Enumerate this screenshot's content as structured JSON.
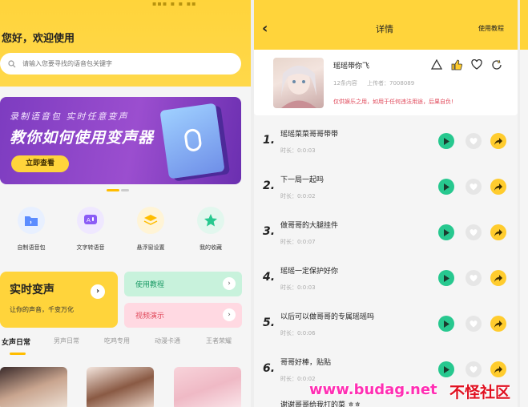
{
  "left": {
    "greeting": "您好，欢迎使用",
    "search": {
      "placeholder": "请输入您要寻找的语音包关键字",
      "icon": "search-icon"
    },
    "banner": {
      "subtitle": "录制语音包 实时任意变声",
      "title": "教你如何使用变声器",
      "button": "立即查看"
    },
    "quick_actions": [
      {
        "label": "自制语音包",
        "icon": "folder-voice-icon",
        "color": "#e8f0ff"
      },
      {
        "label": "文字转语音",
        "icon": "text-to-voice-icon",
        "color": "#efe8ff"
      },
      {
        "label": "悬浮窗设置",
        "icon": "floating-window-icon",
        "color": "#fff4d6"
      },
      {
        "label": "我的收藏",
        "icon": "star-icon",
        "color": "#e2f7ee"
      }
    ],
    "realtime": {
      "title": "实时变声",
      "subtitle": "让你的声音，千变万化"
    },
    "tutorial_card": {
      "label": "使用教程",
      "color": "#c8f2dc"
    },
    "demo_card": {
      "label": "视频演示",
      "color": "#ffd9e2"
    },
    "tabs": [
      "女声日常",
      "男声日常",
      "吃鸡专用",
      "动漫卡通",
      "王者荣耀"
    ],
    "active_tab": 0
  },
  "right": {
    "header": {
      "title": "详情",
      "tutorial": "使用教程"
    },
    "pack": {
      "name": "瑶瑶带你飞",
      "count": "12条内容",
      "uploader": "上传者：7008089",
      "warning": "仅供娱乐之用，如用于任何违法用途，后果自负!"
    },
    "items": [
      {
        "num": "1.",
        "title": "瑶瑶菜菜哥哥带带",
        "duration": "时长：0:0:03"
      },
      {
        "num": "2.",
        "title": "下一局一起吗",
        "duration": "时长：0:0:02"
      },
      {
        "num": "3.",
        "title": "做哥哥的大腿挂件",
        "duration": "时长：0:0:07"
      },
      {
        "num": "4.",
        "title": "瑶瑶一定保护好你",
        "duration": "时长：0:0:03"
      },
      {
        "num": "5.",
        "title": "以后可以做哥哥的专属瑶瑶吗",
        "duration": "时长：0:0:06"
      },
      {
        "num": "6.",
        "title": "哥哥好棒，贴贴",
        "duration": "时长：0:0:02"
      },
      {
        "num": "",
        "title": "谢谢哥哥给我打的菜 ㅎㅎ",
        "duration": ""
      }
    ]
  },
  "watermark": {
    "url": "www.budag.net",
    "brand": "不怪社区"
  },
  "colors": {
    "accent": "#ffd43b",
    "play": "#27c88f",
    "share": "#ffcc2e",
    "warning": "#e0485a"
  }
}
